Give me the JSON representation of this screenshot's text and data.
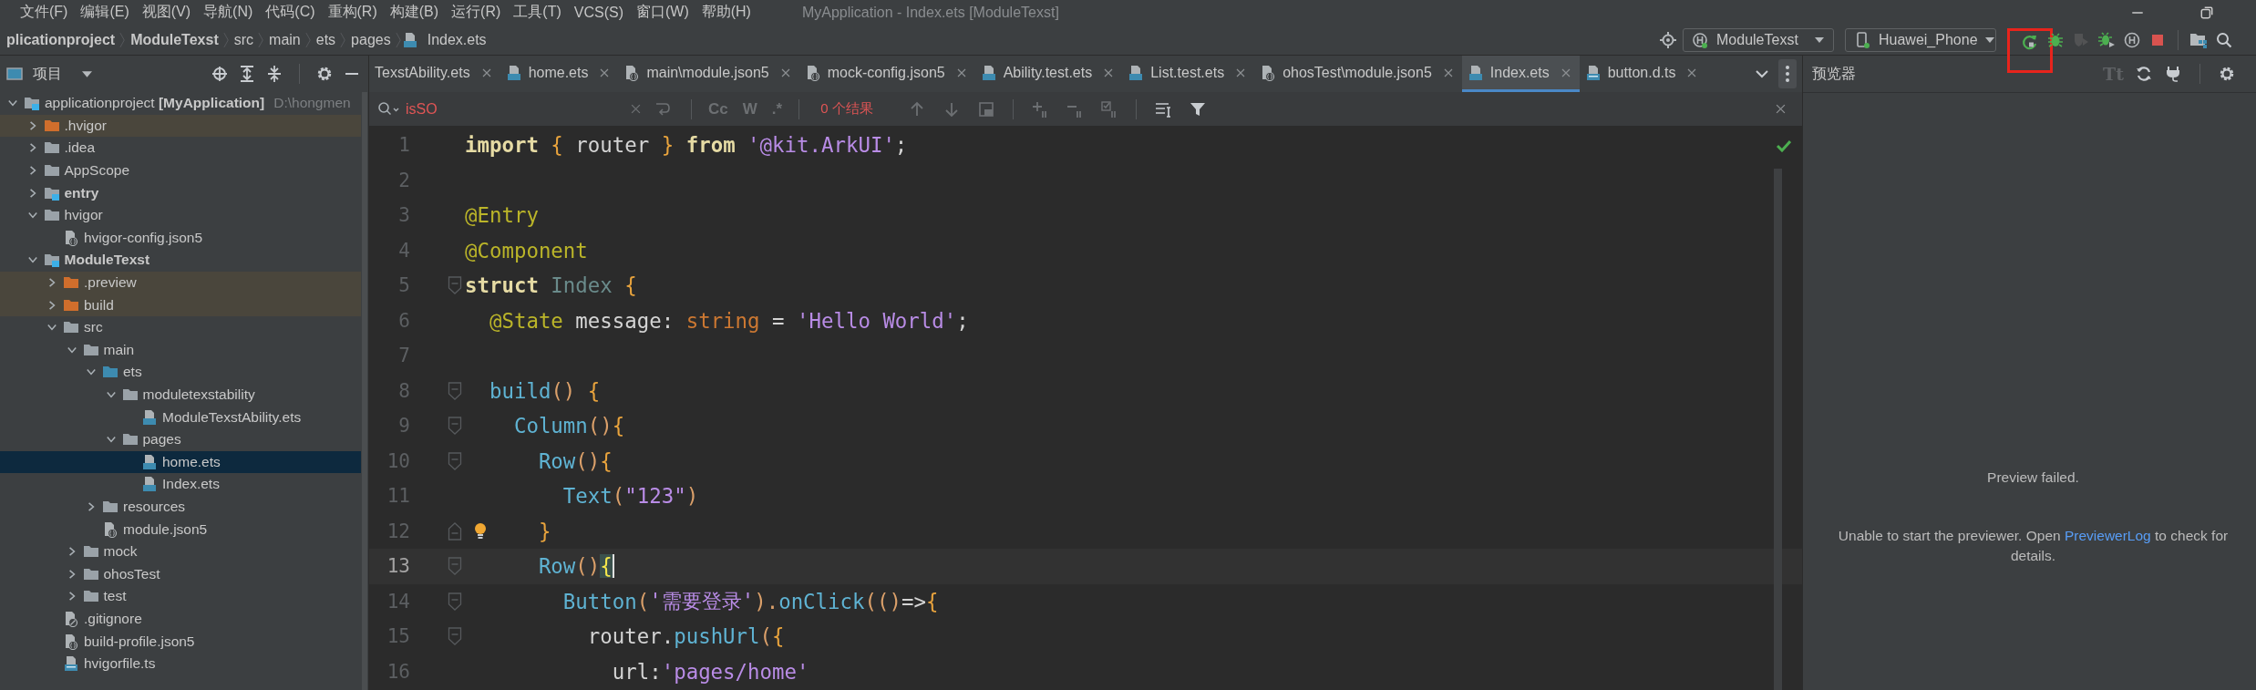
{
  "menu_bar": {
    "items": [
      "文件(F)",
      "编辑(E)",
      "视图(V)",
      "导航(N)",
      "代码(C)",
      "重构(R)",
      "构建(B)",
      "运行(R)",
      "工具(T)",
      "VCS(S)",
      "窗口(W)",
      "帮助(H)"
    ],
    "window_title": "MyApplication - Index.ets [ModuleTexst]"
  },
  "breadcrumb": [
    {
      "label": "plicationproject",
      "kind": "project"
    },
    {
      "label": "ModuleTexst",
      "kind": "module"
    },
    {
      "label": "src",
      "kind": "folder"
    },
    {
      "label": "main",
      "kind": "folder"
    },
    {
      "label": "ets",
      "kind": "folder"
    },
    {
      "label": "pages",
      "kind": "folder"
    },
    {
      "label": "Index.ets",
      "kind": "ets-file"
    }
  ],
  "toolbar": {
    "module_selector": "ModuleTexst",
    "device_selector": "Huawei_Phone",
    "buttons": [
      {
        "kind": "rerun",
        "disabled": false,
        "highlighted": true
      },
      {
        "kind": "debug",
        "disabled": false,
        "highlighted": false
      },
      {
        "kind": "profile",
        "disabled": true,
        "highlighted": false
      },
      {
        "kind": "attach",
        "disabled": false,
        "highlighted": false
      },
      {
        "kind": "hdc",
        "disabled": false,
        "highlighted": false
      },
      {
        "kind": "stop",
        "disabled": false,
        "highlighted": false
      },
      {
        "kind": "structure",
        "disabled": false,
        "highlighted": false
      },
      {
        "kind": "search",
        "disabled": false,
        "highlighted": false
      }
    ]
  },
  "project_panel": {
    "title": "项目",
    "tree": [
      {
        "label": "applicationproject **[MyApplication]**",
        "path": "D:\\hongmen",
        "kind": "project",
        "expanded": true,
        "selected": false,
        "children": [
          {
            "label": ".hvigor",
            "kind": "excluded-folder",
            "expanded": false,
            "selected": false
          },
          {
            "label": ".idea",
            "kind": "folder",
            "expanded": false,
            "selected": false
          },
          {
            "label": "AppScope",
            "kind": "folder",
            "expanded": false,
            "selected": false
          },
          {
            "label": "entry",
            "kind": "module",
            "expanded": false,
            "selected": false
          },
          {
            "label": "hvigor",
            "kind": "folder",
            "expanded": true,
            "selected": false,
            "children": [
              {
                "label": "hvigor-config.json5",
                "kind": "json-file",
                "selected": false
              }
            ]
          },
          {
            "label": "ModuleTexst",
            "kind": "module",
            "expanded": true,
            "selected": false,
            "children": [
              {
                "label": ".preview",
                "kind": "excluded-folder",
                "expanded": false,
                "selected": false
              },
              {
                "label": "build",
                "kind": "excluded-folder",
                "expanded": false,
                "selected": false
              },
              {
                "label": "src",
                "kind": "folder",
                "expanded": true,
                "selected": false,
                "children": [
                  {
                    "label": "main",
                    "kind": "folder",
                    "expanded": true,
                    "selected": false,
                    "children": [
                      {
                        "label": "ets",
                        "kind": "source-folder",
                        "expanded": true,
                        "selected": false,
                        "children": [
                          {
                            "label": "moduletexstability",
                            "kind": "folder",
                            "expanded": true,
                            "selected": false,
                            "children": [
                              {
                                "label": "ModuleTexstAbility.ets",
                                "kind": "ets-file",
                                "selected": false
                              }
                            ]
                          },
                          {
                            "label": "pages",
                            "kind": "folder",
                            "expanded": true,
                            "selected": false,
                            "children": [
                              {
                                "label": "home.ets",
                                "kind": "ets-file",
                                "selected": true
                              },
                              {
                                "label": "Index.ets",
                                "kind": "ets-file",
                                "selected": false
                              }
                            ]
                          }
                        ]
                      },
                      {
                        "label": "resources",
                        "kind": "folder",
                        "expanded": false,
                        "selected": false
                      },
                      {
                        "label": "module.json5",
                        "kind": "json-file",
                        "selected": false
                      }
                    ]
                  },
                  {
                    "label": "mock",
                    "kind": "folder",
                    "expanded": false,
                    "selected": false
                  },
                  {
                    "label": "ohosTest",
                    "kind": "folder",
                    "expanded": false,
                    "selected": false
                  },
                  {
                    "label": "test",
                    "kind": "folder",
                    "expanded": false,
                    "selected": false
                  }
                ]
              },
              {
                "label": ".gitignore",
                "kind": "ignore-file",
                "selected": false
              },
              {
                "label": "build-profile.json5",
                "kind": "json-file",
                "selected": false
              },
              {
                "label": "hvigorfile.ts",
                "kind": "ts-file",
                "selected": false
              }
            ]
          }
        ]
      }
    ]
  },
  "editor": {
    "tabs": [
      {
        "label": "TexstAbility.ets",
        "selected": false
      },
      {
        "label": "home.ets",
        "kind": "ets",
        "selected": false
      },
      {
        "label": "main\\module.json5",
        "kind": "json",
        "selected": false
      },
      {
        "label": "mock-config.json5",
        "kind": "json",
        "selected": false
      },
      {
        "label": "Ability.test.ets",
        "kind": "ets",
        "selected": false
      },
      {
        "label": "List.test.ets",
        "kind": "ets",
        "selected": false
      },
      {
        "label": "ohosTest\\module.json5",
        "kind": "json",
        "selected": false
      },
      {
        "label": "Index.ets",
        "kind": "ets",
        "selected": true
      },
      {
        "label": "button.d.ts",
        "kind": "ts",
        "selected": false
      }
    ],
    "search": {
      "query": "isSO",
      "result": "0 个结果",
      "options": [
        {
          "label": "Cc",
          "selected": false
        },
        {
          "label": "W",
          "selected": false
        },
        {
          "label": ".*",
          "selected": false
        }
      ]
    },
    "lines": [
      {
        "number": "1",
        "current": false,
        "fold_start": false,
        "fold_end": false,
        "bulb": false,
        "tokens": [
          {
            "text": "import",
            "kind": "keyword"
          },
          {
            "text": " { ",
            "kind": "brace"
          },
          {
            "text": "router ",
            "kind": "plain"
          },
          {
            "text": "} ",
            "kind": "brace"
          },
          {
            "text": "from ",
            "kind": "keyword"
          },
          {
            "text": "'@kit.ArkUI'",
            "kind": "string"
          },
          {
            "text": ";",
            "kind": "plain"
          }
        ]
      },
      {
        "number": "2",
        "current": false,
        "fold_start": false,
        "fold_end": false,
        "bulb": false
      },
      {
        "number": "3",
        "current": false,
        "fold_start": false,
        "fold_end": false,
        "bulb": false,
        "tokens": [
          {
            "text": "@Entry",
            "kind": "decorator"
          }
        ]
      },
      {
        "number": "4",
        "current": false,
        "fold_start": false,
        "fold_end": false,
        "bulb": false,
        "tokens": [
          {
            "text": "@Component",
            "kind": "decorator"
          }
        ]
      },
      {
        "number": "5",
        "current": false,
        "fold_start": true,
        "fold_end": false,
        "bulb": false,
        "tokens": [
          {
            "text": "struct",
            "kind": "keyword"
          },
          {
            "text": " Index",
            "kind": "class"
          },
          {
            "text": " {",
            "kind": "brace"
          }
        ]
      },
      {
        "number": "6",
        "current": false,
        "fold_start": false,
        "fold_end": false,
        "bulb": false,
        "tokens": [
          {
            "text": "  @State",
            "kind": "decorator"
          },
          {
            "text": " message: ",
            "kind": "plain"
          },
          {
            "text": "string",
            "kind": "type"
          },
          {
            "text": " = ",
            "kind": "plain"
          },
          {
            "text": "'Hello World'",
            "kind": "string"
          },
          {
            "text": ";",
            "kind": "plain"
          }
        ]
      },
      {
        "number": "7",
        "current": false,
        "fold_start": false,
        "fold_end": false,
        "bulb": false
      },
      {
        "number": "8",
        "current": false,
        "fold_start": true,
        "fold_end": false,
        "bulb": false,
        "tokens": [
          {
            "text": "  build",
            "kind": "function"
          },
          {
            "text": "()",
            "kind": "paren"
          },
          {
            "text": " {",
            "kind": "brace"
          }
        ]
      },
      {
        "number": "9",
        "current": false,
        "fold_start": true,
        "fold_end": false,
        "bulb": false,
        "tokens": [
          {
            "text": "    Column",
            "kind": "function"
          },
          {
            "text": "()",
            "kind": "paren"
          },
          {
            "text": "{",
            "kind": "brace"
          }
        ]
      },
      {
        "number": "10",
        "current": false,
        "fold_start": true,
        "fold_end": false,
        "bulb": false,
        "tokens": [
          {
            "text": "      Row",
            "kind": "function"
          },
          {
            "text": "()",
            "kind": "paren"
          },
          {
            "text": "{",
            "kind": "brace"
          }
        ]
      },
      {
        "number": "11",
        "current": false,
        "fold_start": false,
        "fold_end": false,
        "bulb": false,
        "tokens": [
          {
            "text": "        Text",
            "kind": "function"
          },
          {
            "text": "(",
            "kind": "paren"
          },
          {
            "text": "\"123\"",
            "kind": "string"
          },
          {
            "text": ")",
            "kind": "paren"
          }
        ]
      },
      {
        "number": "12",
        "current": false,
        "fold_start": false,
        "fold_end": true,
        "bulb": true,
        "tokens": [
          {
            "text": "      }",
            "kind": "brace"
          }
        ]
      },
      {
        "number": "13",
        "current": true,
        "fold_start": true,
        "fold_end": false,
        "bulb": false,
        "tokens": [
          {
            "text": "      Row",
            "kind": "function"
          },
          {
            "text": "()",
            "kind": "paren"
          },
          {
            "text": "{",
            "kind": "brace-match"
          }
        ]
      },
      {
        "number": "14",
        "current": false,
        "fold_start": true,
        "fold_end": false,
        "bulb": false,
        "tokens": [
          {
            "text": "        Button",
            "kind": "function"
          },
          {
            "text": "(",
            "kind": "paren"
          },
          {
            "text": "'需要登录'",
            "kind": "string"
          },
          {
            "text": ").",
            "kind": "paren"
          },
          {
            "text": "onClick",
            "kind": "function"
          },
          {
            "text": "(()",
            "kind": "paren"
          },
          {
            "text": "=>",
            "kind": "plain"
          },
          {
            "text": "{",
            "kind": "brace"
          }
        ]
      },
      {
        "number": "15",
        "current": false,
        "fold_start": true,
        "fold_end": false,
        "bulb": false,
        "tokens": [
          {
            "text": "          router.",
            "kind": "plain"
          },
          {
            "text": "pushUrl",
            "kind": "function"
          },
          {
            "text": "(",
            "kind": "paren"
          },
          {
            "text": "{",
            "kind": "brace"
          }
        ]
      },
      {
        "number": "16",
        "current": false,
        "fold_start": false,
        "fold_end": false,
        "bulb": false,
        "tokens": [
          {
            "text": "            url:",
            "kind": "plain"
          },
          {
            "text": "'pages/home'",
            "kind": "string"
          }
        ]
      }
    ]
  },
  "preview_panel": {
    "title": "预览器",
    "font_button": {
      "label": "Tt",
      "disabled": true
    },
    "heading": "Preview failed.",
    "message": {
      "before": "Unable to start the previewer. Open ",
      "link": "PreviewerLog",
      "after": " to check for details."
    }
  }
}
